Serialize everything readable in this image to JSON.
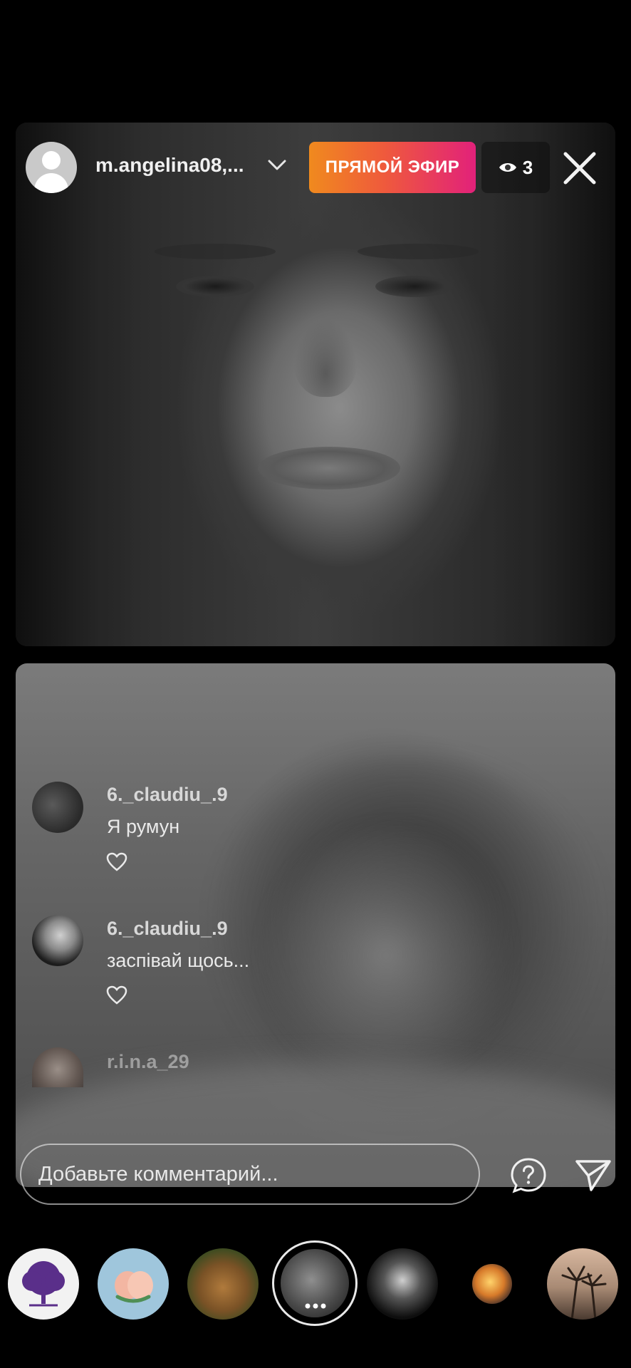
{
  "header": {
    "username": "m.angelina08,...",
    "live_label": "ПРЯМОЙ ЭФИР",
    "viewers_count": "3"
  },
  "comments": [
    {
      "username": "6._claudiu_.9",
      "text": "Я румун"
    },
    {
      "username": "6._claudiu_.9",
      "text": "заспівай щось..."
    },
    {
      "username": "r.i.n.a_29",
      "text": ""
    }
  ],
  "comment_box": {
    "placeholder": "Добавьте комментарий..."
  },
  "colors": {
    "live_gradient_start": "#f08a1e",
    "live_gradient_end": "#e2217a",
    "background": "#000000"
  },
  "icons": [
    "chevron-down-icon",
    "eye-icon",
    "close-icon",
    "heart-icon",
    "question-icon",
    "send-icon",
    "more-icon"
  ]
}
